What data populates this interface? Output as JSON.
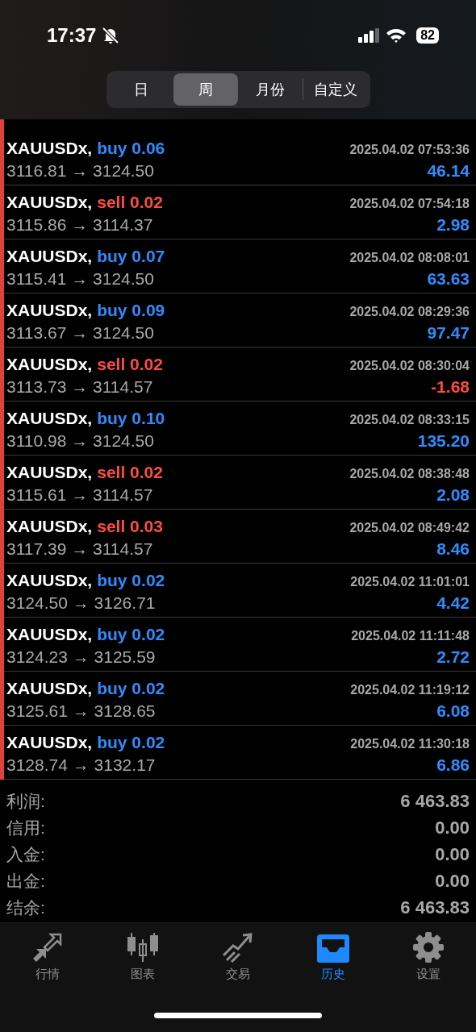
{
  "status_bar": {
    "time": "17:37",
    "battery": "82"
  },
  "period_tabs": [
    {
      "label": "日",
      "selected": false
    },
    {
      "label": "周",
      "selected": true
    },
    {
      "label": "月份",
      "selected": false
    },
    {
      "label": "自定义",
      "selected": false
    }
  ],
  "deals": [
    {
      "symbol": "XAUUSDx,",
      "kind": "buy",
      "volume": "buy 0.06",
      "time": "2025.04.02 07:53:36",
      "prices": "3116.81 → 3124.50",
      "profit": "46.14",
      "loss": false
    },
    {
      "symbol": "XAUUSDx,",
      "kind": "sell",
      "volume": "sell 0.02",
      "time": "2025.04.02 07:54:18",
      "prices": "3115.86 → 3114.37",
      "profit": "2.98",
      "loss": false
    },
    {
      "symbol": "XAUUSDx,",
      "kind": "buy",
      "volume": "buy 0.07",
      "time": "2025.04.02 08:08:01",
      "prices": "3115.41 → 3124.50",
      "profit": "63.63",
      "loss": false
    },
    {
      "symbol": "XAUUSDx,",
      "kind": "buy",
      "volume": "buy 0.09",
      "time": "2025.04.02 08:29:36",
      "prices": "3113.67 → 3124.50",
      "profit": "97.47",
      "loss": false
    },
    {
      "symbol": "XAUUSDx,",
      "kind": "sell",
      "volume": "sell 0.02",
      "time": "2025.04.02 08:30:04",
      "prices": "3113.73 → 3114.57",
      "profit": "-1.68",
      "loss": true
    },
    {
      "symbol": "XAUUSDx,",
      "kind": "buy",
      "volume": "buy 0.10",
      "time": "2025.04.02 08:33:15",
      "prices": "3110.98 → 3124.50",
      "profit": "135.20",
      "loss": false
    },
    {
      "symbol": "XAUUSDx,",
      "kind": "sell",
      "volume": "sell 0.02",
      "time": "2025.04.02 08:38:48",
      "prices": "3115.61 → 3114.57",
      "profit": "2.08",
      "loss": false
    },
    {
      "symbol": "XAUUSDx,",
      "kind": "sell",
      "volume": "sell 0.03",
      "time": "2025.04.02 08:49:42",
      "prices": "3117.39 → 3114.57",
      "profit": "8.46",
      "loss": false
    },
    {
      "symbol": "XAUUSDx,",
      "kind": "buy",
      "volume": "buy 0.02",
      "time": "2025.04.02 11:01:01",
      "prices": "3124.50 → 3126.71",
      "profit": "4.42",
      "loss": false
    },
    {
      "symbol": "XAUUSDx,",
      "kind": "buy",
      "volume": "buy 0.02",
      "time": "2025.04.02 11:11:48",
      "prices": "3124.23 → 3125.59",
      "profit": "2.72",
      "loss": false
    },
    {
      "symbol": "XAUUSDx,",
      "kind": "buy",
      "volume": "buy 0.02",
      "time": "2025.04.02 11:19:12",
      "prices": "3125.61 → 3128.65",
      "profit": "6.08",
      "loss": false
    },
    {
      "symbol": "XAUUSDx,",
      "kind": "buy",
      "volume": "buy 0.02",
      "time": "2025.04.02 11:30:18",
      "prices": "3128.74 → 3132.17",
      "profit": "6.86",
      "loss": false
    }
  ],
  "summary": [
    {
      "label": "利润:",
      "value": "6 463.83"
    },
    {
      "label": "信用:",
      "value": "0.00"
    },
    {
      "label": "入金:",
      "value": "0.00"
    },
    {
      "label": "出金:",
      "value": "0.00"
    },
    {
      "label": "结余:",
      "value": "6 463.83"
    }
  ],
  "tab_bar": [
    {
      "kind": "arrows",
      "label": "行情",
      "selected": false
    },
    {
      "kind": "candles",
      "label": "图表",
      "selected": false
    },
    {
      "kind": "trend",
      "label": "交易",
      "selected": false
    },
    {
      "kind": "inbox",
      "label": "历史",
      "selected": true
    },
    {
      "kind": "gear",
      "label": "设置",
      "selected": false
    }
  ]
}
